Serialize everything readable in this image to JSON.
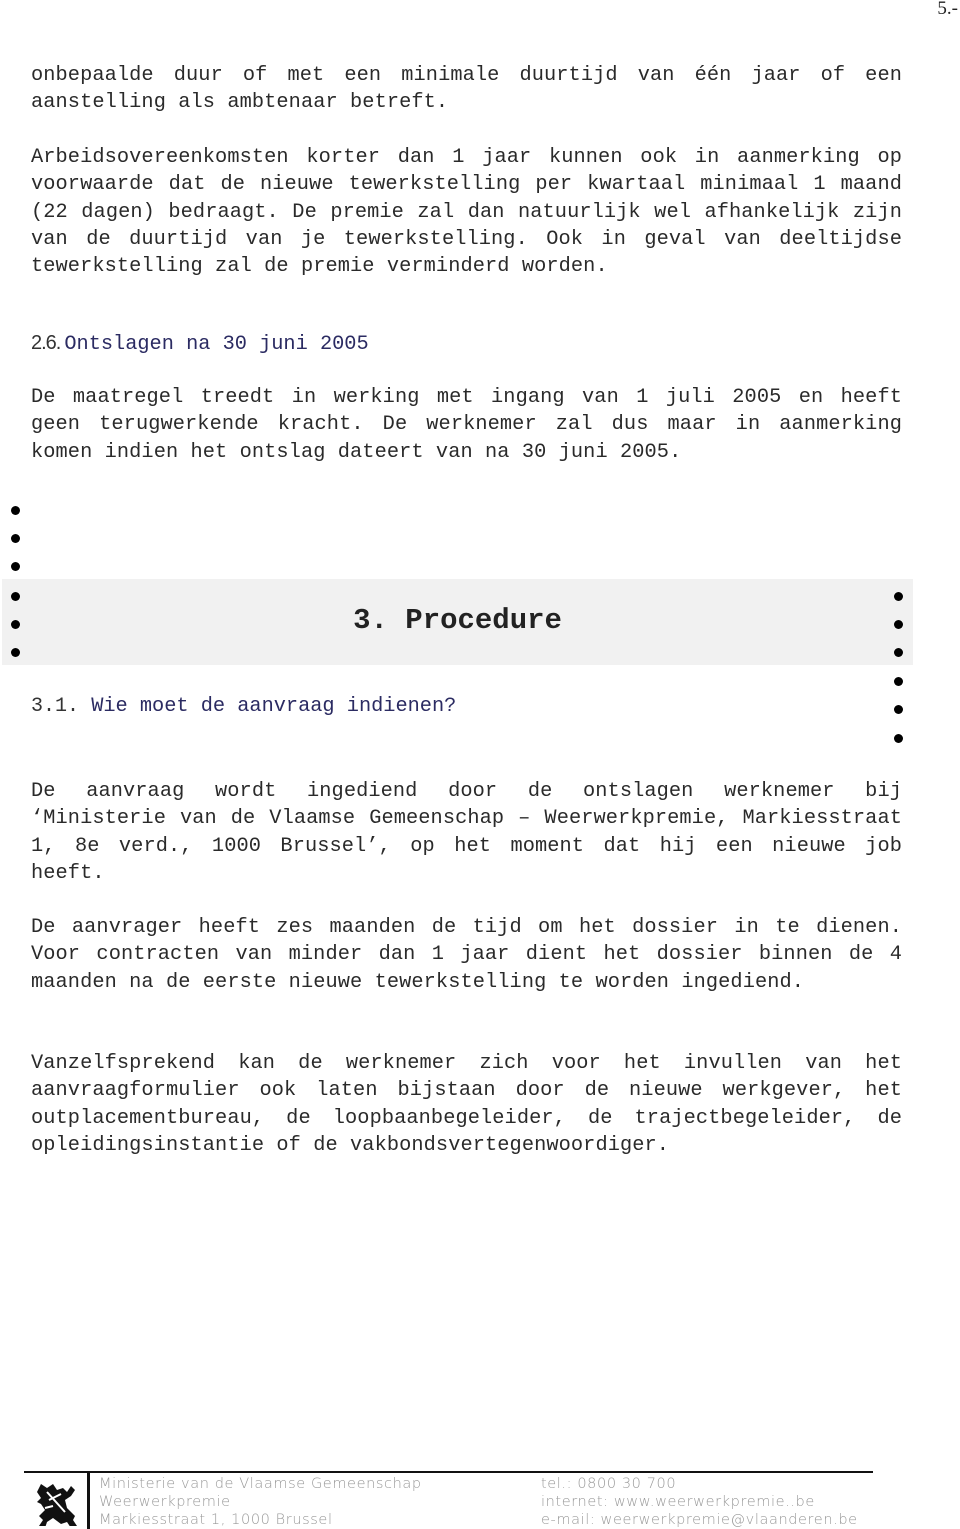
{
  "page": {
    "number": "5.-"
  },
  "paragraphs": {
    "p1": "onbepaalde duur of met een minimale duurtijd van één jaar of een aanstelling als ambtenaar betreft.",
    "p2": "Arbeidsovereenkomsten korter dan 1 jaar kunnen ook in aanmerking op voorwaarde dat de nieuwe tewerkstelling per kwartaal minimaal 1 maand (22 dagen) bedraagt. De premie zal dan natuurlijk wel afhankelijk zijn van de duurtijd van je tewerkstelling. Ook in geval van deeltijdse tewerkstelling zal de premie verminderd worden.",
    "p3": "De maatregel treedt in werking met ingang van 1 juli 2005 en heeft geen terugwerkende kracht. De werknemer zal dus maar in aanmerking komen indien het ontslag dateert van na 30 juni 2005.",
    "p4": "De aanvraag wordt ingediend door de ontslagen werknemer bij ‘Ministerie van de Vlaamse Gemeenschap – Weerwerkpremie, Markiesstraat 1, 8e verd., 1000 Brussel’, op het moment dat hij een nieuwe job heeft.",
    "p5": "De aanvrager heeft zes maanden de tijd om het dossier in te dienen. Voor contracten van minder dan 1 jaar dient het dossier binnen de 4 maanden na de eerste nieuwe tewerkstelling te worden ingediend.",
    "p6": "Vanzelfsprekend kan de werknemer zich voor het invullen van het aanvraagformulier ook laten bijstaan door de nieuwe werkgever, het outplacementbureau, de loopbaanbegeleider, de trajectbegeleider, de opleidingsinstantie of de vakbondsvertegenwoordiger."
  },
  "sections": {
    "s2_6": {
      "number": "2.6.",
      "title": "Ontslagen na 30 juni 2005"
    },
    "s3": {
      "title": "3. Procedure"
    },
    "s3_1": {
      "number": "3.1.",
      "title": "Wie moet de aanvraag indienen?"
    }
  },
  "footer": {
    "logo": "flemish-lion-icon",
    "left": [
      "Ministerie van de Vlaamse Gemeenschap",
      "Weerwerkpremie",
      "Markiesstraat 1, 1000 Brussel"
    ],
    "right": [
      "tel.: 0800 30 700",
      "internet:  www.weerwerkpremie..be",
      "e-mail: weerwerkpremie@vlaanderen.be"
    ]
  }
}
